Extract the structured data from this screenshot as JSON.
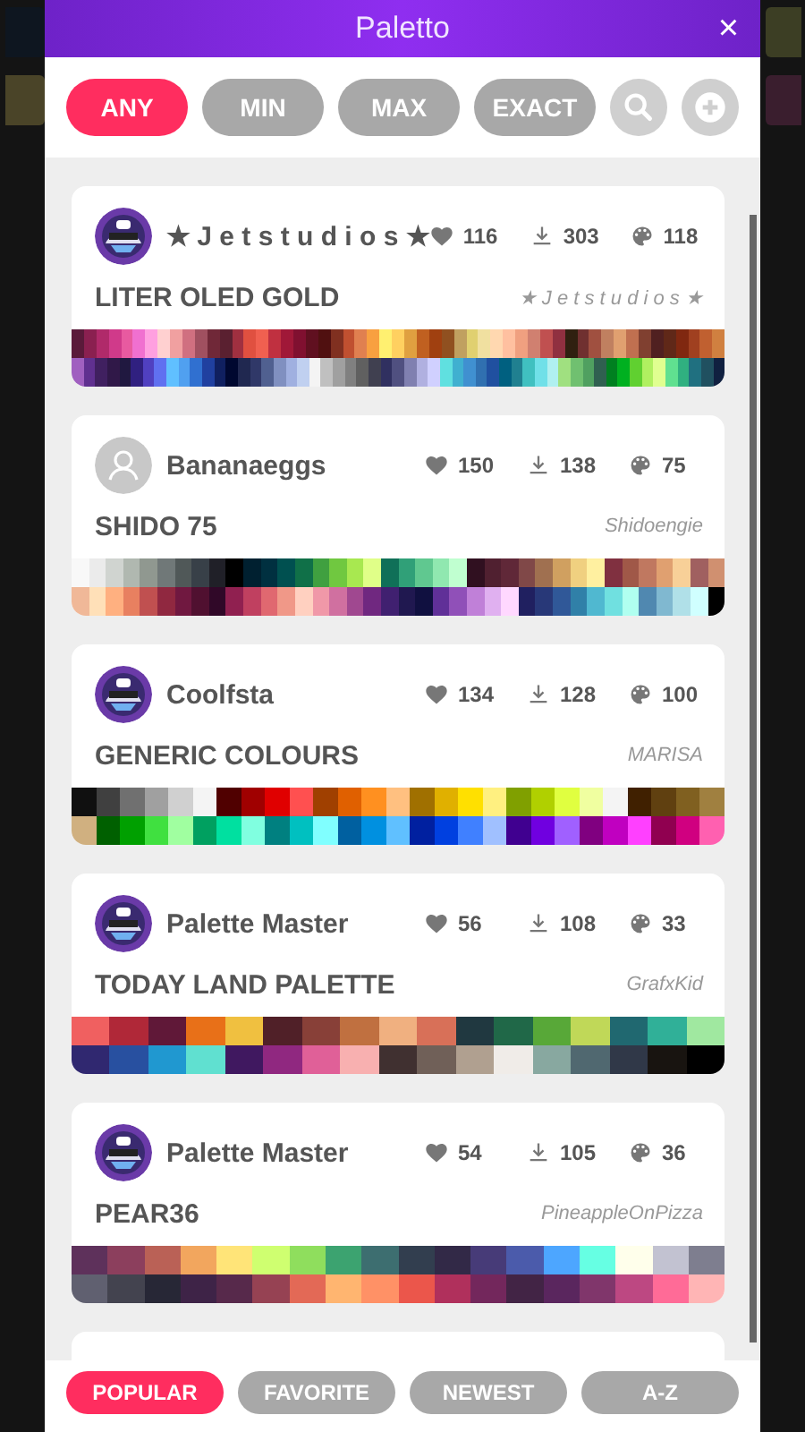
{
  "window": {
    "title": "Paletto",
    "close": "×"
  },
  "filters": [
    {
      "label": "ANY",
      "selected": true
    },
    {
      "label": "MIN",
      "selected": false
    },
    {
      "label": "MAX",
      "selected": false
    },
    {
      "label": "EXACT",
      "selected": false
    }
  ],
  "palettes": [
    {
      "author": "★ J e t s t u d i o s ★",
      "likes": "116",
      "downloads": "303",
      "colors": "118",
      "title": "LITER OLED GOLD",
      "credit": "★ J e t s t u d i o s ★",
      "rows": [
        {
          "swatches": [
            {
              "color": "#5a1a3a"
            },
            {
              "color": "#8a2050"
            },
            {
              "color": "#b02a6a"
            },
            {
              "color": "#d03a8a"
            },
            {
              "color": "#e85aa0"
            },
            {
              "color": "#f070d0"
            },
            {
              "color": "#ffa0e0"
            },
            {
              "color": "#ffd0d0"
            },
            {
              "color": "#f0a0a0"
            },
            {
              "color": "#d07080"
            },
            {
              "color": "#a05060"
            },
            {
              "color": "#702838"
            },
            {
              "color": "#5a2030"
            },
            {
              "color": "#a03040"
            },
            {
              "color": "#e05040"
            },
            {
              "color": "#f06050"
            },
            {
              "color": "#c03040"
            },
            {
              "color": "#a01838"
            },
            {
              "color": "#801030"
            },
            {
              "color": "#601020"
            },
            {
              "color": "#501010"
            },
            {
              "color": "#803020"
            },
            {
              "color": "#c05030"
            },
            {
              "color": "#e08050"
            },
            {
              "color": "#f8a040"
            },
            {
              "color": "#fff070"
            },
            {
              "color": "#ffd060"
            },
            {
              "color": "#e0a040"
            },
            {
              "color": "#c06020"
            },
            {
              "color": "#a04010"
            },
            {
              "color": "#905020"
            },
            {
              "color": "#c0a060"
            },
            {
              "color": "#e0d070"
            },
            {
              "color": "#f0e0a0"
            },
            {
              "color": "#ffd8b0"
            },
            {
              "color": "#ffc0a0"
            },
            {
              "color": "#f0a080"
            },
            {
              "color": "#d08070"
            },
            {
              "color": "#c05050"
            },
            {
              "color": "#903040"
            },
            {
              "color": "#302010"
            },
            {
              "color": "#703030"
            },
            {
              "color": "#a05040"
            },
            {
              "color": "#c08060"
            },
            {
              "color": "#e0a070"
            },
            {
              "color": "#c07050"
            },
            {
              "color": "#804030"
            },
            {
              "color": "#502020"
            },
            {
              "color": "#602818"
            },
            {
              "color": "#802810"
            },
            {
              "color": "#a04020"
            },
            {
              "color": "#c06030"
            },
            {
              "color": "#d08040"
            }
          ]
        },
        {
          "swatches": [
            {
              "color": "#a060c0"
            },
            {
              "color": "#603090"
            },
            {
              "color": "#402060"
            },
            {
              "color": "#301848"
            },
            {
              "color": "#201840"
            },
            {
              "color": "#302080"
            },
            {
              "color": "#5040c0"
            },
            {
              "color": "#6070f0"
            },
            {
              "color": "#60c0ff"
            },
            {
              "color": "#50a0f0"
            },
            {
              "color": "#3070d0"
            },
            {
              "color": "#2040a0"
            },
            {
              "color": "#102060"
            },
            {
              "color": "#000830"
            },
            {
              "color": "#202850"
            },
            {
              "color": "#303868"
            },
            {
              "color": "#506090"
            },
            {
              "color": "#8090c0"
            },
            {
              "color": "#a0b0e0"
            },
            {
              "color": "#c0d0f0"
            },
            {
              "color": "#f4f4f4"
            },
            {
              "color": "#c0c0c0"
            },
            {
              "color": "#a0a0a0"
            },
            {
              "color": "#808080"
            },
            {
              "color": "#606060"
            },
            {
              "color": "#404050"
            },
            {
              "color": "#303060"
            },
            {
              "color": "#505080"
            },
            {
              "color": "#8080b0"
            },
            {
              "color": "#b0b0e0"
            },
            {
              "color": "#d0d0ff"
            },
            {
              "color": "#60e0e0"
            },
            {
              "color": "#40b0d0"
            },
            {
              "color": "#4090d0"
            },
            {
              "color": "#3070b0"
            },
            {
              "color": "#2050a0"
            },
            {
              "color": "#006080"
            },
            {
              "color": "#208090"
            },
            {
              "color": "#40c0c0"
            },
            {
              "color": "#70e0e8"
            },
            {
              "color": "#b0f0f0"
            },
            {
              "color": "#a0e080"
            },
            {
              "color": "#70c070"
            },
            {
              "color": "#50a060"
            },
            {
              "color": "#306050"
            },
            {
              "color": "#008020"
            },
            {
              "color": "#00b020"
            },
            {
              "color": "#60d030"
            },
            {
              "color": "#b0f060"
            },
            {
              "color": "#e0ff90"
            },
            {
              "color": "#60e090"
            },
            {
              "color": "#30b080"
            },
            {
              "color": "#207080"
            },
            {
              "color": "#205060"
            },
            {
              "color": "#102040"
            }
          ]
        }
      ]
    },
    {
      "author": "Bananaeggs",
      "avatar": {
        "kind": "placeholder"
      },
      "likes": "150",
      "downloads": "138",
      "colors": "75",
      "title": "SHIDO 75",
      "credit": "Shidoengie",
      "rows": [
        {
          "swatches": [
            {
              "color": "#f8f8f8"
            },
            {
              "color": "#ebebeb"
            },
            {
              "color": "#d0d4d0"
            },
            {
              "color": "#b0b8b0"
            },
            {
              "color": "#909890"
            },
            {
              "color": "#707878"
            },
            {
              "color": "#505858"
            },
            {
              "color": "#384048"
            },
            {
              "color": "#202028"
            },
            {
              "color": "#000000"
            },
            {
              "color": "#002030"
            },
            {
              "color": "#003040"
            },
            {
              "color": "#005050"
            },
            {
              "color": "#107048"
            },
            {
              "color": "#40a040"
            },
            {
              "color": "#70c840"
            },
            {
              "color": "#a8e850"
            },
            {
              "color": "#e0ff88"
            },
            {
              "color": "#107058"
            },
            {
              "color": "#30a078"
            },
            {
              "color": "#60c890"
            },
            {
              "color": "#90e8b0"
            },
            {
              "color": "#c0ffd0"
            },
            {
              "color": "#301020"
            },
            {
              "color": "#502030"
            },
            {
              "color": "#602838"
            },
            {
              "color": "#804848"
            },
            {
              "color": "#a07050"
            },
            {
              "color": "#d0a060"
            },
            {
              "color": "#f0d080"
            },
            {
              "color": "#fff0a0"
            },
            {
              "color": "#803040"
            },
            {
              "color": "#a05848"
            },
            {
              "color": "#c07860"
            },
            {
              "color": "#e0a070"
            },
            {
              "color": "#f8d098"
            },
            {
              "color": "#a06060"
            },
            {
              "color": "#d09070"
            }
          ]
        },
        {
          "swatches": [
            {
              "color": "#f0b898"
            },
            {
              "color": "#ffe0b8"
            },
            {
              "color": "#ffb080"
            },
            {
              "color": "#e88060"
            },
            {
              "color": "#c05050"
            },
            {
              "color": "#902840"
            },
            {
              "color": "#701840"
            },
            {
              "color": "#501030"
            },
            {
              "color": "#300828"
            },
            {
              "color": "#902050"
            },
            {
              "color": "#c04060"
            },
            {
              "color": "#e06870"
            },
            {
              "color": "#f09888"
            },
            {
              "color": "#ffd0c0"
            },
            {
              "color": "#f098a8"
            },
            {
              "color": "#d070a0"
            },
            {
              "color": "#a04890"
            },
            {
              "color": "#702880"
            },
            {
              "color": "#402070"
            },
            {
              "color": "#201850"
            },
            {
              "color": "#101040"
            },
            {
              "color": "#603098"
            },
            {
              "color": "#9050b8"
            },
            {
              "color": "#c080d8"
            },
            {
              "color": "#e0b0f0"
            },
            {
              "color": "#ffd8ff"
            },
            {
              "color": "#202060"
            },
            {
              "color": "#283878"
            },
            {
              "color": "#305898"
            },
            {
              "color": "#3080a8"
            },
            {
              "color": "#50b8d0"
            },
            {
              "color": "#70e0e0"
            },
            {
              "color": "#b0fff0"
            },
            {
              "color": "#5088b0"
            },
            {
              "color": "#80b8d0"
            },
            {
              "color": "#b0e0e8"
            },
            {
              "color": "#d0ffff"
            },
            {
              "color": "#000000"
            }
          ]
        }
      ]
    },
    {
      "author": "Coolfsta",
      "likes": "134",
      "downloads": "128",
      "colors": "100",
      "title": "GENERIC COLOURS",
      "credit": "MARISA",
      "rows": [
        {
          "swatches": [
            {
              "color": "#101010"
            },
            {
              "color": "#404040"
            },
            {
              "color": "#707070"
            },
            {
              "color": "#a0a0a0"
            },
            {
              "color": "#d0d0d0"
            },
            {
              "color": "#f4f4f4"
            },
            {
              "color": "#500000"
            },
            {
              "color": "#a00000"
            },
            {
              "color": "#e00000"
            },
            {
              "color": "#ff5050"
            },
            {
              "color": "#a04000"
            },
            {
              "color": "#e06000"
            },
            {
              "color": "#ff9020"
            },
            {
              "color": "#ffc080"
            },
            {
              "color": "#a07000"
            },
            {
              "color": "#e0b000"
            },
            {
              "color": "#ffe000"
            },
            {
              "color": "#fff080"
            },
            {
              "color": "#80a000"
            },
            {
              "color": "#b0d000"
            },
            {
              "color": "#e0ff40"
            },
            {
              "color": "#f0ffa0"
            },
            {
              "color": "#f4f4f4"
            },
            {
              "color": "#402000"
            },
            {
              "color": "#604010"
            },
            {
              "color": "#806020"
            },
            {
              "color": "#a08040"
            }
          ]
        },
        {
          "swatches": [
            {
              "color": "#d0b080"
            },
            {
              "color": "#006000"
            },
            {
              "color": "#00a000"
            },
            {
              "color": "#40e040"
            },
            {
              "color": "#a0ffa0"
            },
            {
              "color": "#00a060"
            },
            {
              "color": "#00e0a0"
            },
            {
              "color": "#80ffe0"
            },
            {
              "color": "#008080"
            },
            {
              "color": "#00c0c0"
            },
            {
              "color": "#80ffff"
            },
            {
              "color": "#0060a0"
            },
            {
              "color": "#0090e0"
            },
            {
              "color": "#60c0ff"
            },
            {
              "color": "#0020a0"
            },
            {
              "color": "#0040e0"
            },
            {
              "color": "#4080ff"
            },
            {
              "color": "#a0c0ff"
            },
            {
              "color": "#400090"
            },
            {
              "color": "#7000e0"
            },
            {
              "color": "#a060ff"
            },
            {
              "color": "#800080"
            },
            {
              "color": "#c000c0"
            },
            {
              "color": "#ff40ff"
            },
            {
              "color": "#900050"
            },
            {
              "color": "#d00080"
            },
            {
              "color": "#ff60b0"
            }
          ]
        }
      ]
    },
    {
      "author": "Palette Master",
      "likes": "56",
      "downloads": "108",
      "colors": "33",
      "title": "TODAY LAND PALETTE",
      "credit": "GrafxKid",
      "rows": [
        {
          "swatches": [
            {
              "color": "#f06060"
            },
            {
              "color": "#b02838"
            },
            {
              "color": "#601838"
            },
            {
              "color": "#e87018"
            },
            {
              "color": "#f0c040"
            },
            {
              "color": "#502028"
            },
            {
              "color": "#884038"
            },
            {
              "color": "#c07040"
            },
            {
              "color": "#f0b080"
            },
            {
              "color": "#d87058"
            },
            {
              "color": "#203840"
            },
            {
              "color": "#206848"
            },
            {
              "color": "#58a838"
            },
            {
              "color": "#c0d858"
            },
            {
              "color": "#206870"
            },
            {
              "color": "#30b098"
            },
            {
              "color": "#a0e8a0"
            }
          ]
        },
        {
          "swatches": [
            {
              "color": "#302870"
            },
            {
              "color": "#2850a0"
            },
            {
              "color": "#2098d0"
            },
            {
              "color": "#60e0d0"
            },
            {
              "color": "#401860"
            },
            {
              "color": "#902880"
            },
            {
              "color": "#e06098"
            },
            {
              "color": "#f8b0b0"
            },
            {
              "color": "#403030"
            },
            {
              "color": "#706058"
            },
            {
              "color": "#b0a090"
            },
            {
              "color": "#f0ece8"
            },
            {
              "color": "#88a8a0"
            },
            {
              "color": "#506870"
            },
            {
              "color": "#303848"
            },
            {
              "color": "#181410"
            },
            {
              "color": "#000000"
            }
          ]
        }
      ]
    },
    {
      "author": "Palette Master",
      "likes": "54",
      "downloads": "105",
      "colors": "36",
      "title": "PEAR36",
      "credit": "PineappleOnPizza",
      "rows": [
        {
          "swatches": [
            {
              "color": "#5e315b"
            },
            {
              "color": "#8c3f5d"
            },
            {
              "color": "#ba6156"
            },
            {
              "color": "#f2a65e"
            },
            {
              "color": "#ffe478"
            },
            {
              "color": "#cfff70"
            },
            {
              "color": "#8fde5d"
            },
            {
              "color": "#3ca370"
            },
            {
              "color": "#3d6e70"
            },
            {
              "color": "#323e4f"
            },
            {
              "color": "#322947"
            },
            {
              "color": "#473b78"
            },
            {
              "color": "#4b5bab"
            },
            {
              "color": "#4da6ff"
            },
            {
              "color": "#66ffe3"
            },
            {
              "color": "#ffffeb"
            },
            {
              "color": "#c2c2d1"
            },
            {
              "color": "#7e7e8f"
            }
          ]
        },
        {
          "swatches": [
            {
              "color": "#606070"
            },
            {
              "color": "#43434f"
            },
            {
              "color": "#272736"
            },
            {
              "color": "#3e2347"
            },
            {
              "color": "#57294b"
            },
            {
              "color": "#964253"
            },
            {
              "color": "#e36956"
            },
            {
              "color": "#ffb570"
            },
            {
              "color": "#ff9166"
            },
            {
              "color": "#eb564b"
            },
            {
              "color": "#b0305c"
            },
            {
              "color": "#73275c"
            },
            {
              "color": "#422445"
            },
            {
              "color": "#5a265e"
            },
            {
              "color": "#80366b"
            },
            {
              "color": "#bd4882"
            },
            {
              "color": "#ff6b97"
            },
            {
              "color": "#ffb5b5"
            }
          ]
        }
      ]
    }
  ],
  "sort_tabs": [
    {
      "label": "POPULAR",
      "selected": true
    },
    {
      "label": "FAVORITE",
      "selected": false
    },
    {
      "label": "NEWEST",
      "selected": false
    },
    {
      "label": "A-Z",
      "selected": false
    }
  ]
}
